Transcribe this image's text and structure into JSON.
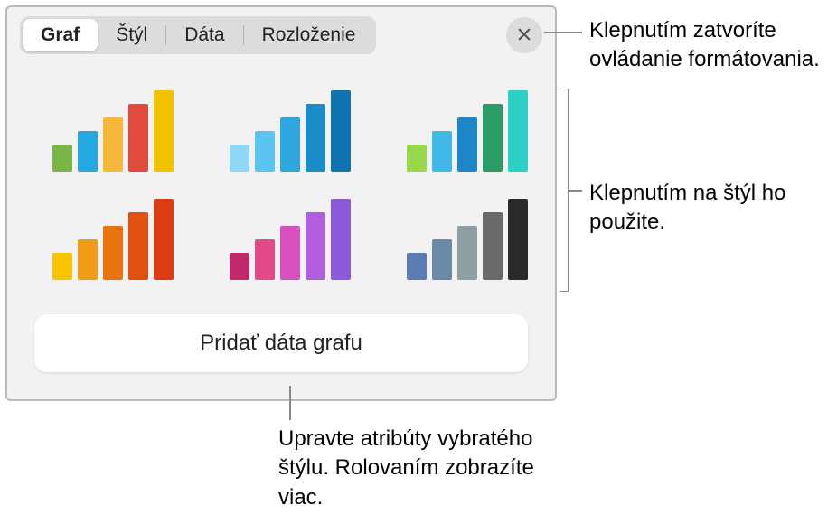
{
  "tabs": {
    "chart": "Graf",
    "style": "Štýl",
    "data": "Dáta",
    "layout": "Rozloženie"
  },
  "activeTab": "chart",
  "addDataButton": "Pridať dáta grafu",
  "callouts": {
    "close": "Klepnutím zatvoríte ovládanie formátovania.",
    "style": "Klepnutím na štýl ho použite.",
    "attributes": "Upravte atribúty vybratého štýlu. Rolovaním zobrazíte viac."
  },
  "chartStyles": [
    {
      "name": "style-1",
      "colors": [
        "#7bb547",
        "#25a7e0",
        "#f6b73c",
        "#e04b3e",
        "#f0c200"
      ]
    },
    {
      "name": "style-2",
      "colors": [
        "#8fd8f7",
        "#5bc4f0",
        "#2ea6e0",
        "#1a8cc9",
        "#0f73b0"
      ]
    },
    {
      "name": "style-3",
      "colors": [
        "#98d84a",
        "#3fb9e8",
        "#1f87c9",
        "#2a9d66",
        "#2dd0c4"
      ]
    },
    {
      "name": "style-4",
      "colors": [
        "#f6c400",
        "#f09b1a",
        "#e8730f",
        "#e05010",
        "#dc3c14"
      ]
    },
    {
      "name": "style-5",
      "colors": [
        "#c02a6b",
        "#e24a8a",
        "#d84fbf",
        "#b05de0",
        "#8a5ad8"
      ]
    },
    {
      "name": "style-6",
      "colors": [
        "#5b7bb3",
        "#6b8aa8",
        "#8f9ea0",
        "#6a6a6a",
        "#2a2a2a"
      ]
    }
  ],
  "barHeights": [
    30,
    45,
    60,
    75,
    90
  ]
}
